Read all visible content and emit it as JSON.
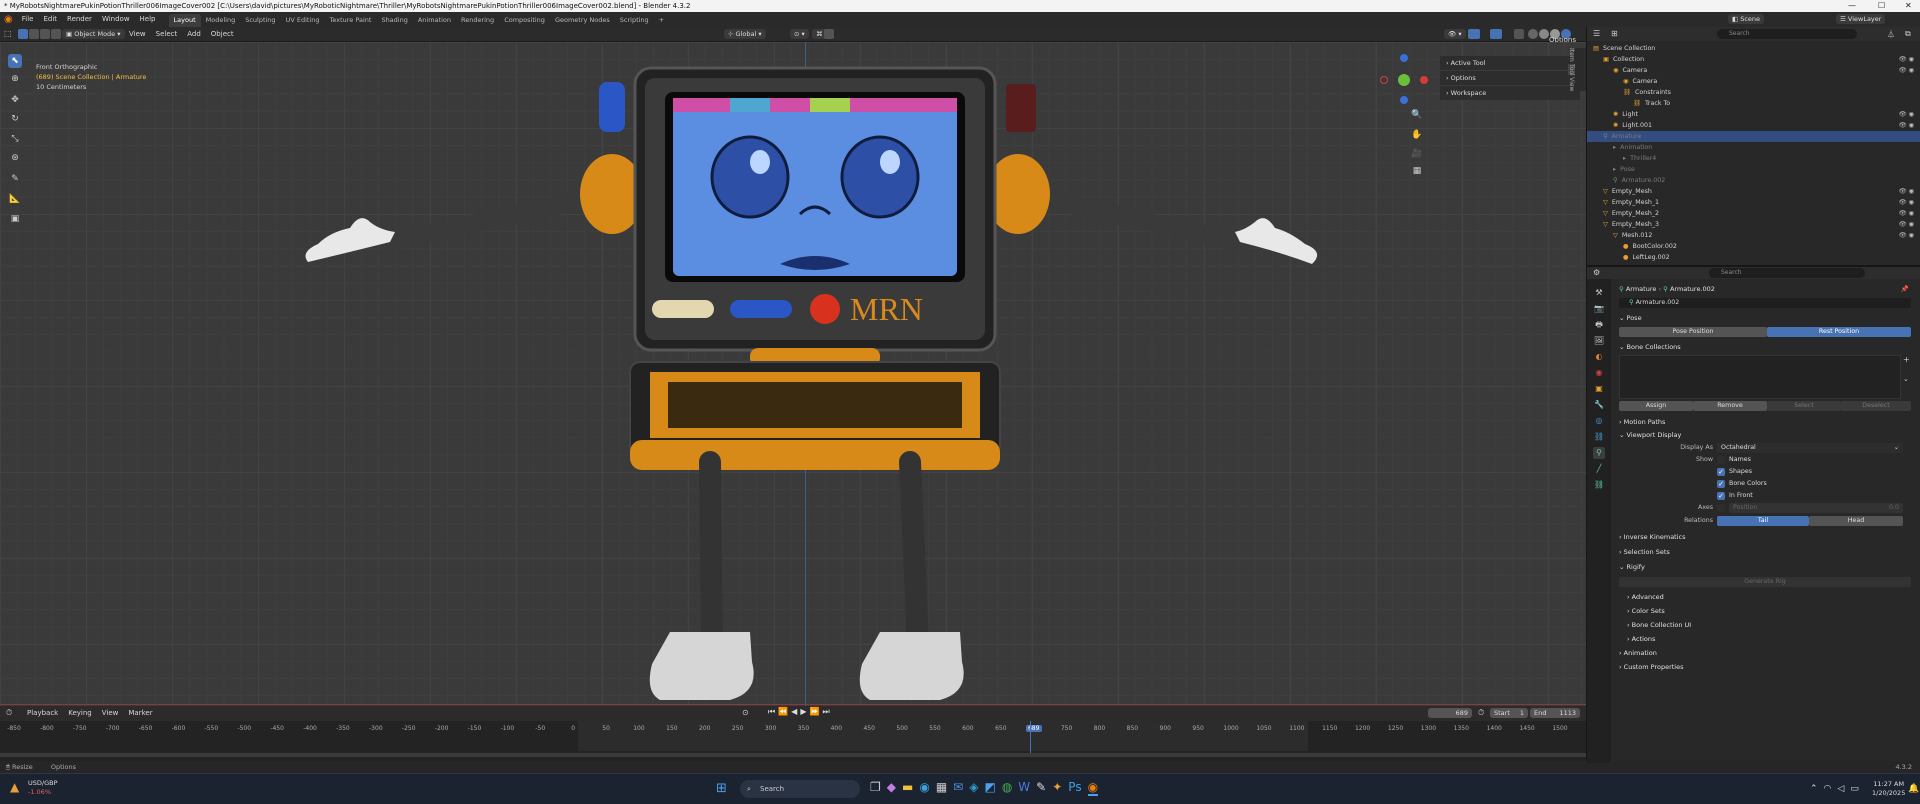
{
  "window": {
    "title": "* MyRobotsNightmarePukinPotionThriller006ImageCover002 [C:\\Users\\david\\pictures\\MyRoboticNightmare\\Thriller\\MyRobotsNightmarePukinPotionThriller006ImageCover002.blend] - Blender 4.3.2",
    "minimize": "—",
    "maximize": "☐",
    "close": "✕"
  },
  "menu": [
    "File",
    "Edit",
    "Render",
    "Window",
    "Help"
  ],
  "workspaces": [
    "Layout",
    "Modeling",
    "Sculpting",
    "UV Editing",
    "Texture Paint",
    "Shading",
    "Animation",
    "Rendering",
    "Compositing",
    "Geometry Nodes",
    "Scripting",
    "+"
  ],
  "scene": {
    "label": "Scene",
    "view_layer": "ViewLayer"
  },
  "viewport_header": {
    "mode": "Object Mode",
    "menus": [
      "View",
      "Select",
      "Add",
      "Object"
    ],
    "orientation": "Global",
    "options": "Options"
  },
  "overlay_text": {
    "view": "Front Orthographic",
    "collection": "(689) Scene Collection | Armature",
    "scale": "10 Centimeters"
  },
  "npanel": [
    "Active Tool",
    "Options",
    "Workspace"
  ],
  "npanel_tabs": [
    "Item",
    "Tool",
    "View"
  ],
  "robot": {
    "screen_label": "MRN"
  },
  "timeline": {
    "menus": [
      "Playback",
      "Keying",
      "View",
      "Marker"
    ],
    "current_frame": "689",
    "start_label": "Start",
    "start": "1",
    "end_label": "End",
    "end": "1113",
    "ticks": [
      "-850",
      "-800",
      "-750",
      "-700",
      "-650",
      "-600",
      "-550",
      "-500",
      "-450",
      "-400",
      "-350",
      "-300",
      "-250",
      "-200",
      "-150",
      "-100",
      "-50",
      "0",
      "50",
      "100",
      "150",
      "200",
      "250",
      "300",
      "350",
      "400",
      "450",
      "500",
      "550",
      "600",
      "650",
      "689",
      "750",
      "800",
      "850",
      "900",
      "950",
      "1000",
      "1050",
      "1100",
      "1150",
      "1200",
      "1250",
      "1300",
      "1350",
      "1400",
      "1450",
      "1500"
    ]
  },
  "status": {
    "left": "Resize",
    "options": "Options",
    "version": "4.3.2"
  },
  "outliner": {
    "search": "Search",
    "rows": [
      {
        "indent": 0,
        "icon": "▤",
        "label": "Scene Collection",
        "dim": false
      },
      {
        "indent": 1,
        "icon": "▣",
        "label": "Collection",
        "dim": false
      },
      {
        "indent": 2,
        "icon": "◉",
        "label": "Camera",
        "dim": false
      },
      {
        "indent": 3,
        "icon": "◉",
        "label": "Camera",
        "dim": false
      },
      {
        "indent": 3,
        "icon": "⛓",
        "label": "Constraints",
        "dim": false
      },
      {
        "indent": 4,
        "icon": "⛓",
        "label": "Track To",
        "dim": false
      },
      {
        "indent": 2,
        "icon": "✺",
        "label": "Light",
        "dim": false
      },
      {
        "indent": 2,
        "icon": "✺",
        "label": "Light.001",
        "dim": false
      },
      {
        "indent": 1,
        "icon": "⚲",
        "label": "Armature",
        "dim": true,
        "sel": true
      },
      {
        "indent": 2,
        "icon": "▸",
        "label": "Animation",
        "dim": true
      },
      {
        "indent": 3,
        "icon": "▸",
        "label": "Thriller4",
        "dim": true
      },
      {
        "indent": 2,
        "icon": "▸",
        "label": "Pose",
        "dim": true
      },
      {
        "indent": 2,
        "icon": "⚲",
        "label": "Armature.002",
        "dim": true
      },
      {
        "indent": 1,
        "icon": "▽",
        "label": "Empty_Mesh",
        "dim": false
      },
      {
        "indent": 1,
        "icon": "▽",
        "label": "Empty_Mesh_1",
        "dim": false
      },
      {
        "indent": 1,
        "icon": "▽",
        "label": "Empty_Mesh_2",
        "dim": false
      },
      {
        "indent": 1,
        "icon": "▽",
        "label": "Empty_Mesh_3",
        "dim": false
      },
      {
        "indent": 2,
        "icon": "▽",
        "label": "Mesh.012",
        "dim": false
      },
      {
        "indent": 3,
        "icon": "●",
        "label": "BootColor.002",
        "dim": false
      },
      {
        "indent": 3,
        "icon": "●",
        "label": "LeftLeg.002",
        "dim": false
      }
    ]
  },
  "properties": {
    "search": "Search",
    "breadcrumb": [
      "Armature",
      "Armature.002"
    ],
    "data_name": "Armature.002",
    "pose": {
      "title": "Pose",
      "pose_position": "Pose Position",
      "rest_position": "Rest Position"
    },
    "bone_collections": {
      "title": "Bone Collections",
      "assign": "Assign",
      "remove": "Remove",
      "select": "Select",
      "deselect": "Deselect"
    },
    "motion_paths": "Motion Paths",
    "viewport_display": {
      "title": "Viewport Display",
      "display_as_label": "Display As",
      "display_as": "Octahedral",
      "show_label": "Show",
      "names": "Names",
      "shapes": "Shapes",
      "bone_colors": "Bone Colors",
      "in_front": "In Front",
      "axes_label": "Axes",
      "position_label": "Position",
      "position_value": "0.0",
      "relations_label": "Relations",
      "tail": "Tail",
      "head": "Head"
    },
    "sections": [
      "Inverse Kinematics",
      "Selection Sets",
      "Rigify"
    ],
    "generate_rig": "Generate Rig",
    "rigify_subs": [
      "Advanced",
      "Color Sets",
      "Bone Collection UI",
      "Actions"
    ],
    "bottom_sections": [
      "Animation",
      "Custom Properties"
    ]
  },
  "taskbar": {
    "currency": "USD/GBP",
    "change": "-1.06%",
    "search": "Search",
    "time": "11:27 AM",
    "date": "1/20/2025"
  },
  "colors": {
    "accent": "#4772b3",
    "orange": "#d98a1e",
    "screen_blue": "#5b8ee0",
    "negative": "#e06060"
  }
}
